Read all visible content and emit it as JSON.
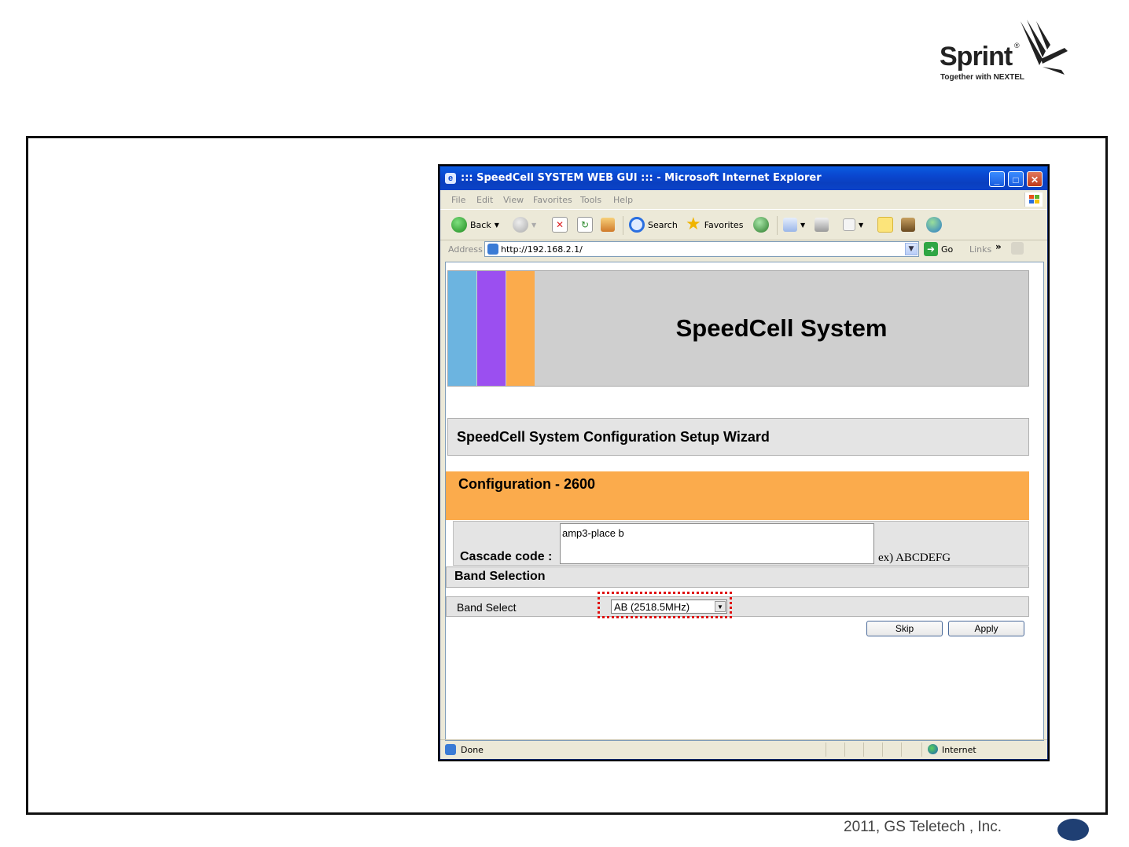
{
  "brand": {
    "logo_word": "Sprint",
    "logo_tagline": "Together with NEXTEL",
    "logo_mark_icon": "sprint-wing-icon"
  },
  "footer": {
    "copyright": "2011, GS Teletech , Inc."
  },
  "browser": {
    "title": "::: SpeedCell SYSTEM WEB GUI ::: - Microsoft Internet Explorer",
    "menu": [
      "File",
      "Edit",
      "View",
      "Favorites",
      "Tools",
      "Help"
    ],
    "toolbar": {
      "back_label": "Back",
      "search_label": "Search",
      "favorites_label": "Favorites"
    },
    "address": {
      "label": "Address",
      "url": "http://192.168.2.1/",
      "go_label": "Go",
      "links_label": "Links"
    },
    "status": {
      "text": "Done",
      "zone": "Internet"
    }
  },
  "page": {
    "header_title": "SpeedCell System",
    "stripe_colors": [
      "#6cb4e0",
      "#9b4ff0",
      "#fbab4c"
    ],
    "wizard_title": "SpeedCell System Configuration Setup Wizard",
    "config_title": "Configuration - 2600",
    "cascade": {
      "label": "Cascade code :",
      "value": "amp3-place b",
      "example": "ex) ABCDEFG"
    },
    "band_section_title": "Band Selection",
    "band_select": {
      "label": "Band Select",
      "selected": "AB (2518.5MHz)"
    },
    "buttons": {
      "skip": "Skip",
      "apply": "Apply"
    }
  }
}
